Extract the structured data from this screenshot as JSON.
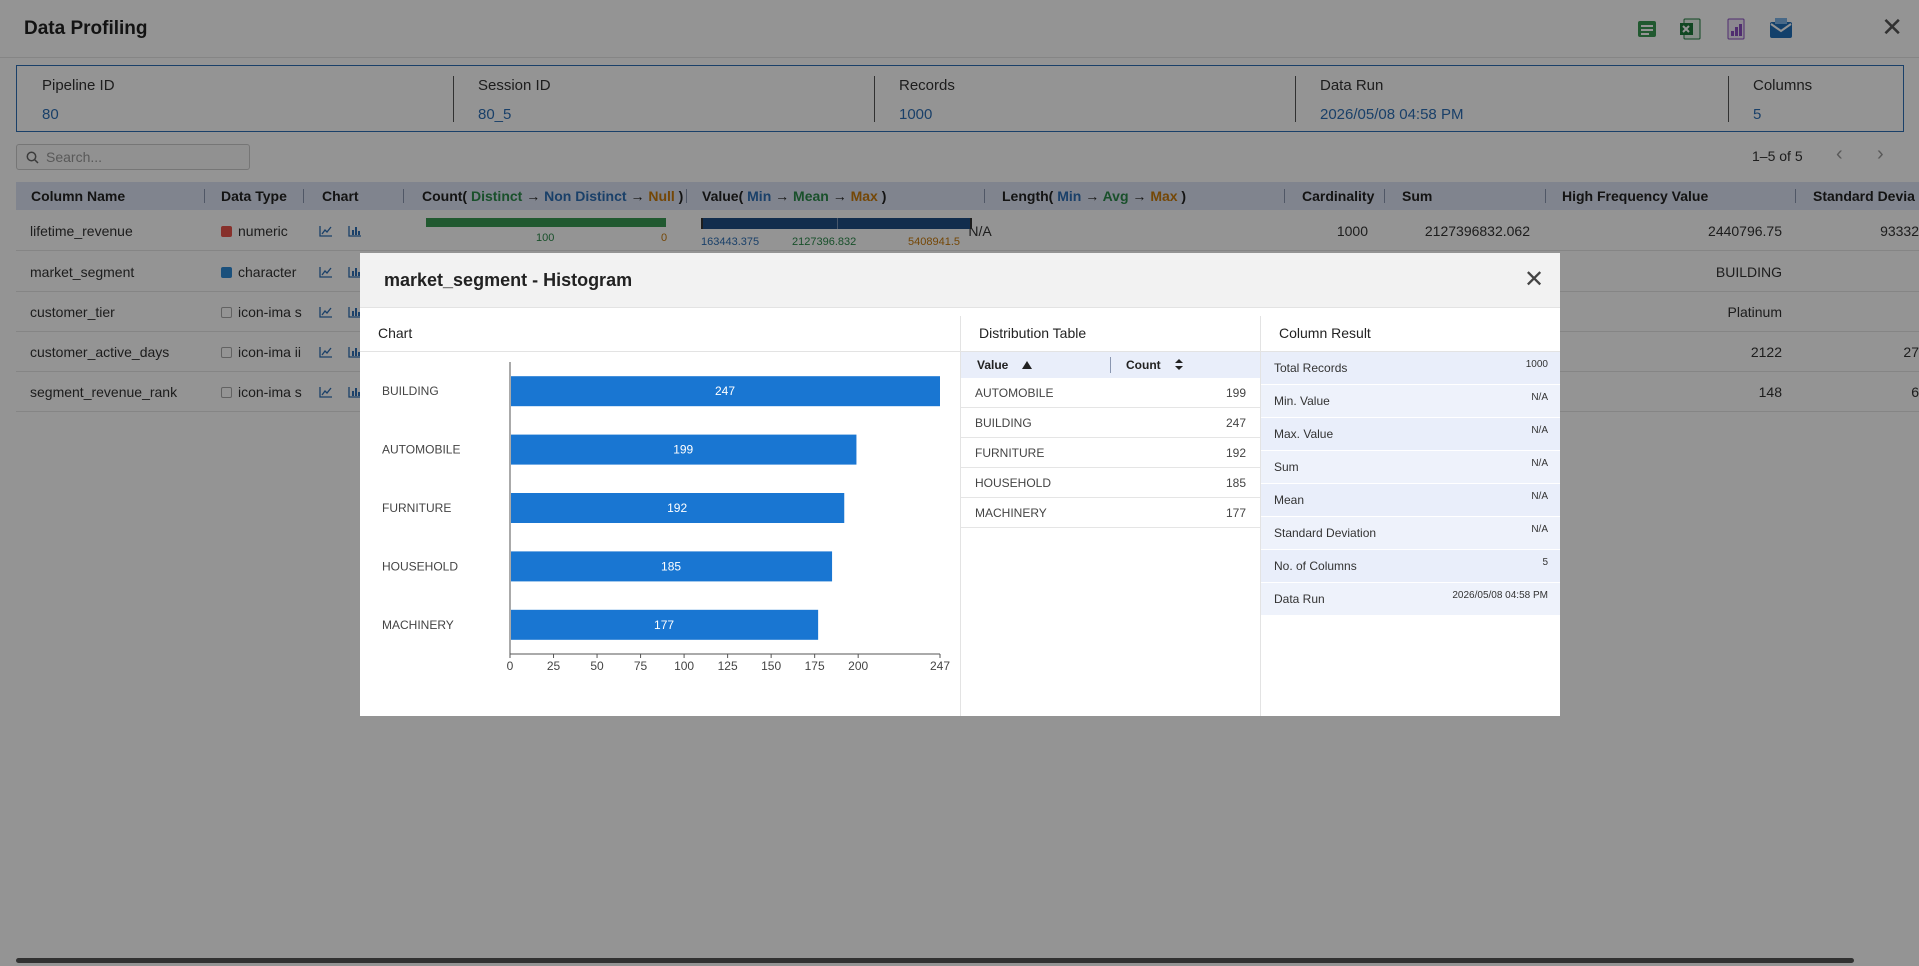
{
  "page": {
    "title": "Data Profiling",
    "toolbar_icons": [
      "export-csv-icon",
      "export-excel-icon",
      "export-pdf-icon",
      "email-icon"
    ],
    "close_glyph": "✕"
  },
  "info": [
    {
      "label": "Pipeline ID",
      "value": "80"
    },
    {
      "label": "Session ID",
      "value": "80_5"
    },
    {
      "label": "Records",
      "value": "1000"
    },
    {
      "label": "Data Run",
      "value": "2026/05/08 04:58 PM"
    },
    {
      "label": "Columns",
      "value": "5"
    }
  ],
  "search": {
    "placeholder": "Search..."
  },
  "pager": {
    "text": "1–5 of 5",
    "prev": "‹",
    "next": "›"
  },
  "grid": {
    "headers": {
      "column_name": "Column Name",
      "data_type": "Data Type",
      "chart": "Chart",
      "count_prefix": "Count( ",
      "count_distinct": "Distinct",
      "count_non_distinct": "Non Distinct",
      "count_null": "Null",
      "count_suffix": " )",
      "value_prefix": "Value( ",
      "value_min": "Min",
      "value_mean": "Mean",
      "value_max": "Max",
      "value_suffix": " )",
      "length_prefix": "Length( ",
      "length_min": "Min",
      "length_avg": "Avg",
      "length_max": "Max",
      "length_suffix": " )",
      "arrow": "→",
      "cardinality": "Cardinality",
      "sum": "Sum",
      "high_frequency_value": "High Frequency Value",
      "standard_deviation": "Standard Devia"
    },
    "rows": [
      {
        "name": "lifetime_revenue",
        "dtype": "numeric",
        "count_distinct": "100",
        "count_null": "0",
        "value_min": "163443.375",
        "value_mean": "2127396.832",
        "value_max": "5408941.5",
        "length": "N/A",
        "cardinality": "1000",
        "sum": "2127396832.062",
        "hfv": "2440796.75",
        "std": "93332"
      },
      {
        "name": "market_segment",
        "dtype": "character",
        "hfv": "BUILDING",
        "std": ""
      },
      {
        "name": "customer_tier",
        "dtype": "icon-ima s",
        "hfv": "Platinum",
        "std": ""
      },
      {
        "name": "customer_active_days",
        "dtype": "icon-ima ii",
        "hfv": "2122",
        "std": "27"
      },
      {
        "name": "segment_revenue_rank",
        "dtype": "icon-ima s",
        "hfv": "148",
        "std": "6"
      }
    ],
    "colors": {
      "numeric_icon": "#e8534a",
      "character_icon": "#2d8ad6"
    }
  },
  "modal": {
    "title": "market_segment - Histogram",
    "close_glyph": "✕",
    "chart_panel_title": "Chart",
    "distribution_panel_title": "Distribution Table",
    "column_result_title": "Column Result",
    "distribution": {
      "headers": {
        "value": "Value",
        "count": "Count"
      },
      "rows": [
        {
          "value": "AUTOMOBILE",
          "count": "199"
        },
        {
          "value": "BUILDING",
          "count": "247"
        },
        {
          "value": "FURNITURE",
          "count": "192"
        },
        {
          "value": "HOUSEHOLD",
          "count": "185"
        },
        {
          "value": "MACHINERY",
          "count": "177"
        }
      ]
    },
    "column_result": [
      {
        "key": "Total Records",
        "value": "1000"
      },
      {
        "key": "Min. Value",
        "value": "N/A"
      },
      {
        "key": "Max. Value",
        "value": "N/A"
      },
      {
        "key": "Sum",
        "value": "N/A"
      },
      {
        "key": "Mean",
        "value": "N/A"
      },
      {
        "key": "Standard Deviation",
        "value": "N/A"
      },
      {
        "key": "No. of Columns",
        "value": "5"
      },
      {
        "key": "Data Run",
        "value": "2026/05/08 04:58 PM"
      }
    ]
  },
  "chart_data": {
    "type": "bar",
    "orientation": "horizontal",
    "categories": [
      "BUILDING",
      "AUTOMOBILE",
      "FURNITURE",
      "HOUSEHOLD",
      "MACHINERY"
    ],
    "values": [
      247,
      199,
      192,
      185,
      177
    ],
    "xlim": [
      0,
      247
    ],
    "xticks": [
      0,
      25,
      50,
      75,
      100,
      125,
      150,
      175,
      200,
      247
    ],
    "bar_color": "#1976d2",
    "grid": false
  }
}
